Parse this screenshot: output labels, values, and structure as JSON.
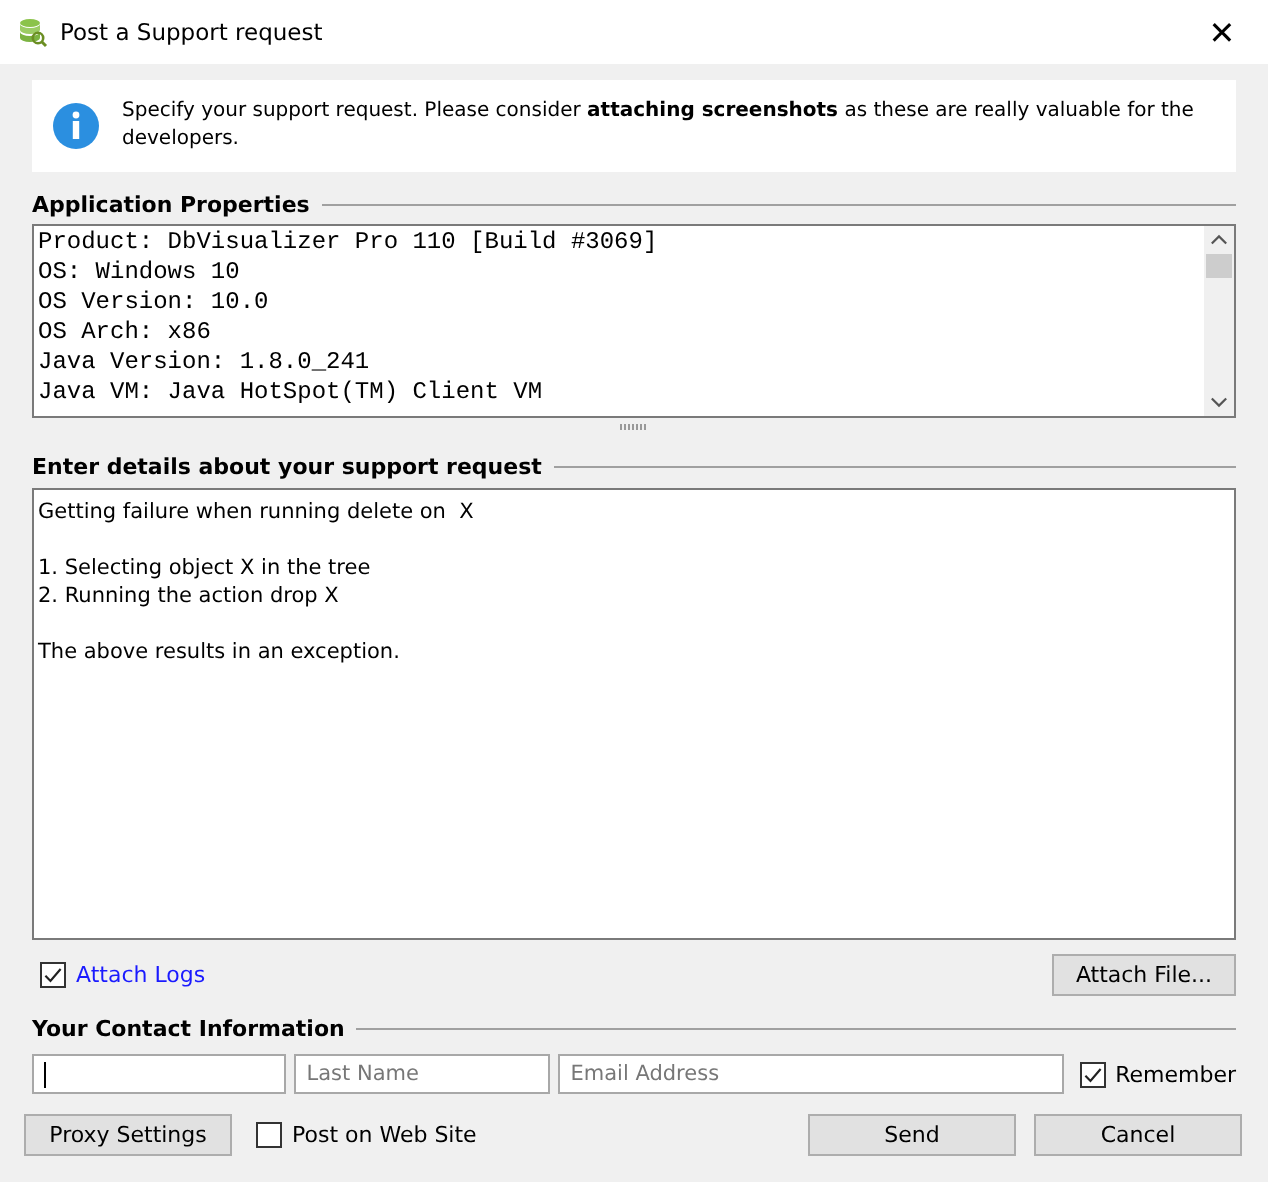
{
  "window": {
    "title": "Post a Support request",
    "close": "✕"
  },
  "info": {
    "text": "Specify your support request. Please consider **attaching screenshots** as these are really valuable for the developers."
  },
  "properties": {
    "heading": "Application Properties",
    "lines": [
      "Product: DbVisualizer Pro 110 [Build #3069]",
      "OS: Windows 10",
      "OS Version: 10.0",
      "OS Arch: x86",
      "Java Version: 1.8.0_241",
      "Java VM: Java HotSpot(TM) Client VM"
    ]
  },
  "details": {
    "heading": "Enter details about your support request",
    "value": "Getting failure when running delete on  X\n\n1. Selecting object X in the tree\n2. Running the action drop X\n\nThe above results in an exception."
  },
  "attach_logs": {
    "label": "Attach Logs",
    "checked": true
  },
  "attach_file": "Attach File...",
  "contact": {
    "heading": "Your Contact Information",
    "last_name": {
      "placeholder": "Last Name"
    },
    "email": {
      "placeholder": "Email Address"
    },
    "remember": {
      "label": "Remember",
      "checked": true
    }
  },
  "proxy_settings": "Proxy Settings",
  "post_on_web_site": {
    "label": "Post on Web Site",
    "checked": false
  },
  "buttons": [
    "Send",
    "Cancel"
  ]
}
